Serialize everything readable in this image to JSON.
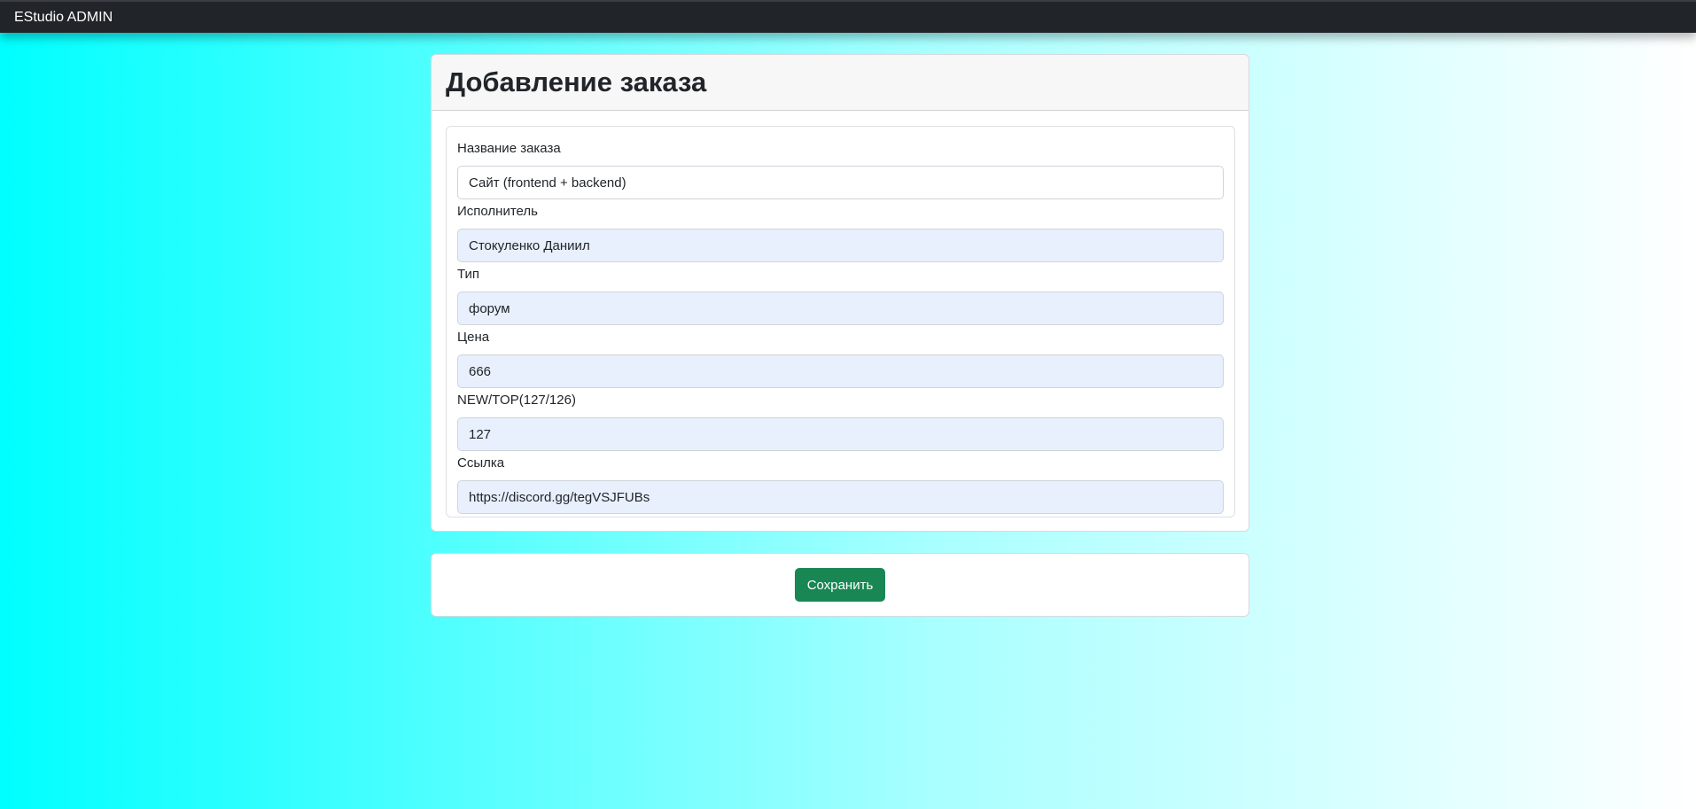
{
  "navbar": {
    "brand": "EStudio ADMIN"
  },
  "form": {
    "title": "Добавление заказа",
    "fields": [
      {
        "label": "Название заказа",
        "value": "Сайт (frontend + backend)",
        "autofilled": false
      },
      {
        "label": "Исполнитель",
        "value": "Стокуленко Даниил",
        "autofilled": true
      },
      {
        "label": "Тип",
        "value": "форум",
        "autofilled": true
      },
      {
        "label": "Цена",
        "value": "666",
        "autofilled": true
      },
      {
        "label": "NEW/TOP(127/126)",
        "value": "127",
        "autofilled": true
      },
      {
        "label": "Ссылка",
        "value": "https://discord.gg/tegVSJFUBs",
        "autofilled": true
      }
    ],
    "save_label": "Сохранить"
  },
  "colors": {
    "navbar_bg": "#212529",
    "accent_green": "#198754",
    "autofill_bg": "#e8f0fe",
    "gradient_start": "#00ffff",
    "gradient_end": "#ffffff"
  }
}
